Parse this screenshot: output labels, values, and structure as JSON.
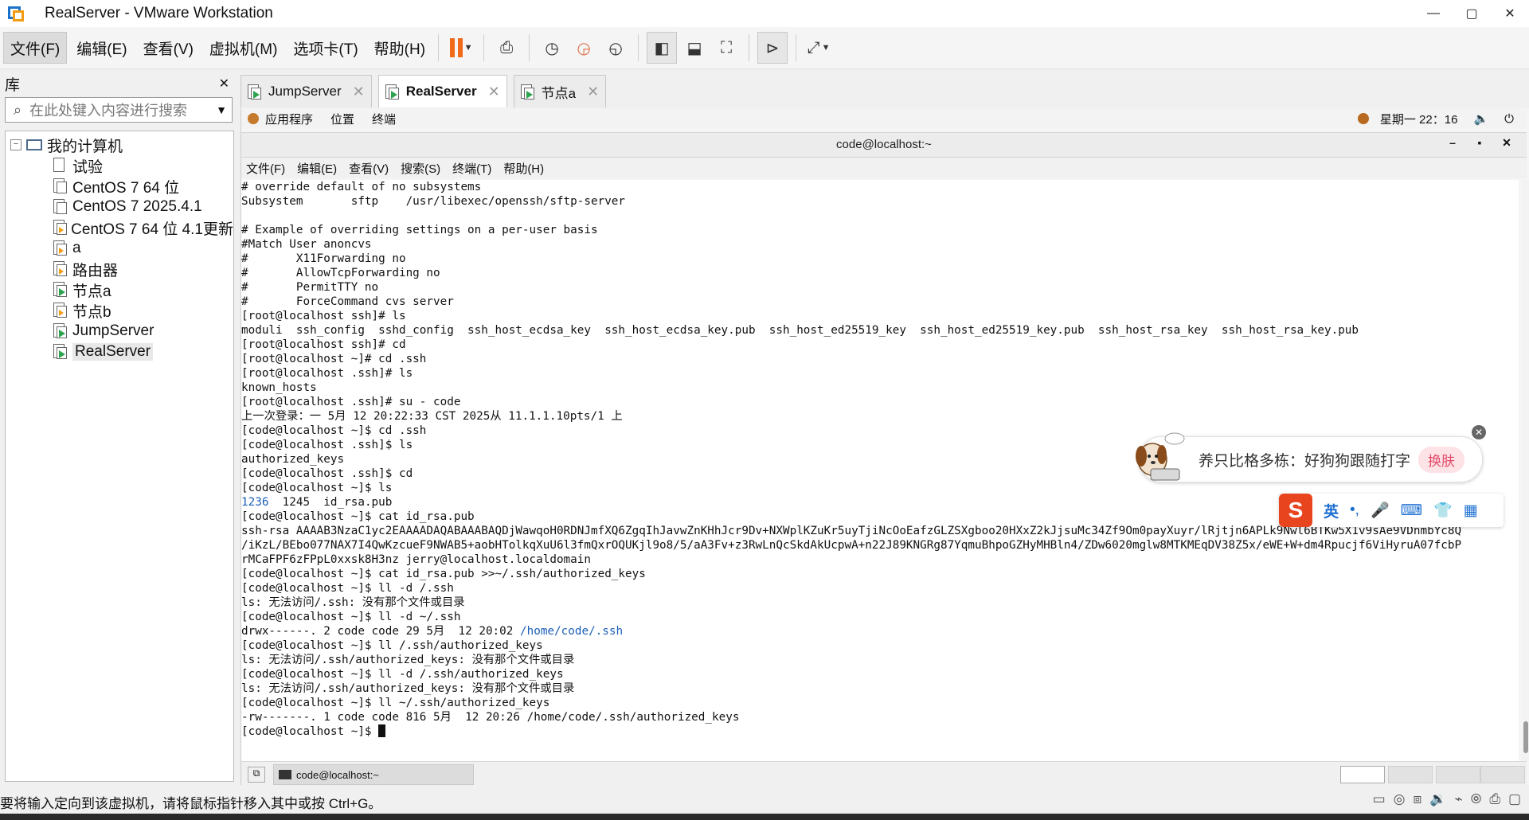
{
  "window": {
    "title": "RealServer - VMware Workstation",
    "min": "—",
    "max": "▢",
    "close": "✕"
  },
  "menubar": {
    "items": [
      "文件(F)",
      "编辑(E)",
      "查看(V)",
      "虚拟机(M)",
      "选项卡(T)",
      "帮助(H)"
    ]
  },
  "library": {
    "title": "库",
    "close": "✕",
    "search_placeholder": "在此处键入内容进行搜索",
    "root": "我的计算机",
    "vms": [
      "试验",
      "CentOS 7 64 位",
      "CentOS 7 2025.4.1",
      "CentOS 7 64 位 4.1更新",
      "a",
      "路由器",
      "节点a",
      "节点b",
      "JumpServer",
      "RealServer"
    ]
  },
  "tabs": [
    {
      "label": "JumpServer",
      "close": "✕"
    },
    {
      "label": "RealServer",
      "close": "✕"
    },
    {
      "label": "节点a",
      "close": "✕"
    }
  ],
  "gnome": {
    "menus": [
      "应用程序",
      "位置",
      "终端"
    ],
    "clock": "星期一 22：16"
  },
  "terminal": {
    "title": "code@localhost:~",
    "menus": [
      "文件(F)",
      "编辑(E)",
      "查看(V)",
      "搜索(S)",
      "终端(T)",
      "帮助(H)"
    ],
    "lines": [
      "# override default of no subsystems",
      "Subsystem       sftp    /usr/libexec/openssh/sftp-server",
      "",
      "# Example of overriding settings on a per-user basis",
      "#Match User anoncvs",
      "#       X11Forwarding no",
      "#       AllowTcpForwarding no",
      "#       PermitTTY no",
      "#       ForceCommand cvs server",
      "[root@localhost ssh]# ls",
      "moduli  ssh_config  sshd_config  ssh_host_ecdsa_key  ssh_host_ecdsa_key.pub  ssh_host_ed25519_key  ssh_host_ed25519_key.pub  ssh_host_rsa_key  ssh_host_rsa_key.pub",
      "[root@localhost ssh]# cd",
      "[root@localhost ~]# cd .ssh",
      "[root@localhost .ssh]# ls",
      "known_hosts",
      "[root@localhost .ssh]# su - code",
      "上一次登录：一 5月 12 20:22:33 CST 2025从 11.1.1.10pts/1 上",
      "[code@localhost ~]$ cd .ssh",
      "[code@localhost .ssh]$ ls",
      "authorized_keys",
      "[code@localhost .ssh]$ cd",
      "[code@localhost ~]$ ls",
      "1236  1245  id_rsa.pub",
      "[code@localhost ~]$ cat id_rsa.pub",
      "ssh-rsa AAAAB3NzaC1yc2EAAAADAQABAAABAQDjWawqoH0RDNJmfXQ6ZgqIhJavwZnKHhJcr9Dv+NXWplKZuKr5uyTjiNcOoEafzGLZSXgboo20HXxZ2kJjsuMc34Zf9Om0payXuyr/lRjtjn6APLk9Nwl6BTKw5X1v9sAe9VDnmbYc8Q",
      "/iKzL/BEbo077NAX7I4QwKzcueF9NWAB5+aobHTolkqXuU6l3fmQxrOQUKjl9o8/5/aA3Fv+z3RwLnQcSkdAkUcpwA+n22J89KNGRg87YqmuBhpoGZHyMHBln4/ZDw6020mglw8MTKMEqDV38Z5x/eWE+W+dm4Rpucjf6ViHyruA07fcbP",
      "rMCaFPF6zFPpL0xxsk8H3nz jerry@localhost.localdomain",
      "[code@localhost ~]$ cat id_rsa.pub >>~/.ssh/authorized_keys",
      "[code@localhost ~]$ ll -d /.ssh",
      "ls: 无法访问/.ssh: 没有那个文件或目录",
      "[code@localhost ~]$ ll -d ~/.ssh",
      "drwx------. 2 code code 29 5月  12 20:02 /home/code/.ssh",
      "[code@localhost ~]$ ll /.ssh/authorized_keys",
      "ls: 无法访问/.ssh/authorized_keys: 没有那个文件或目录",
      "[code@localhost ~]$ ll -d /.ssh/authorized_keys",
      "ls: 无法访问/.ssh/authorized_keys: 没有那个文件或目录",
      "[code@localhost ~]$ ll ~/.ssh/authorized_keys",
      "-rw-------. 1 code code 816 5月  12 20:26 /home/code/.ssh/authorized_keys",
      "[code@localhost ~]$ "
    ],
    "taskbar_item": "code@localhost:~"
  },
  "ime": {
    "promo": "养只比格多栋：好狗狗跟随打字",
    "button": "换肤",
    "mode": "英",
    "bar_icons": [
      "•,",
      "🎤",
      "⌨",
      "👕",
      "▦"
    ]
  },
  "statusbar": {
    "message": "要将输入定向到该虚拟机，请将鼠标指针移入其中或按 Ctrl+G。"
  }
}
